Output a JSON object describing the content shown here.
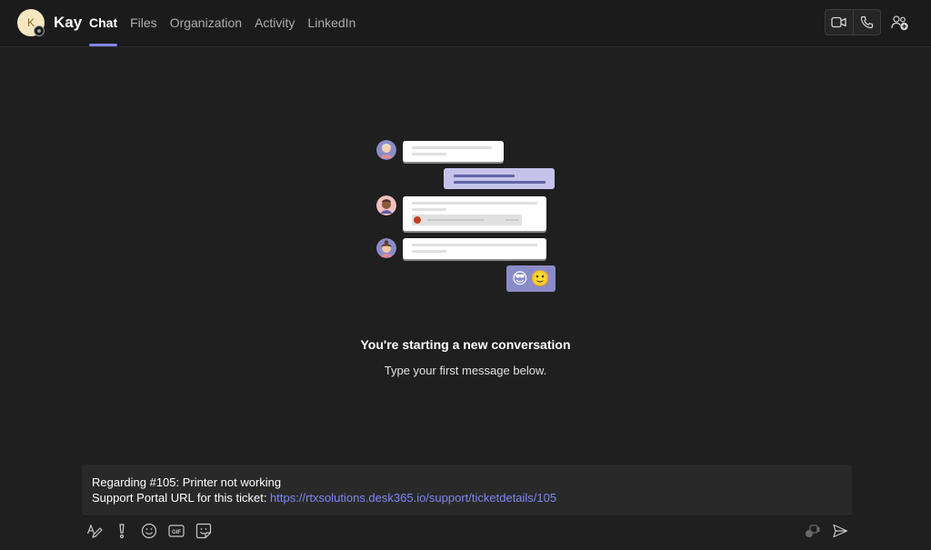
{
  "header": {
    "avatar_initial": "K",
    "user_name": "Kay",
    "tabs": [
      {
        "label": "Chat",
        "active": true
      },
      {
        "label": "Files",
        "active": false
      },
      {
        "label": "Organization",
        "active": false
      },
      {
        "label": "Activity",
        "active": false
      },
      {
        "label": "LinkedIn",
        "active": false
      }
    ],
    "actions": {
      "video_call_icon": "video-camera-icon",
      "audio_call_icon": "phone-icon",
      "add_people_icon": "people-add-icon"
    }
  },
  "empty_state": {
    "title": "You're starting a new conversation",
    "subtitle": "Type your first message below.",
    "emojis": [
      "😎",
      "🙂"
    ]
  },
  "compose": {
    "line1": "Regarding #105: Printer not working",
    "line2_prefix": "Support Portal URL for this ticket: ",
    "link_text": "https://rtxsolutions.desk365.io/support/ticketdetails/105"
  },
  "toolbar": {
    "left_icons": [
      "format-icon",
      "important-icon",
      "emoji-icon",
      "gif-icon",
      "sticker-icon"
    ],
    "right_icons": [
      "loop-icon",
      "send-icon"
    ]
  },
  "colors": {
    "accent": "#7f85f5",
    "background": "#1f1f1f",
    "header_background": "#1b1b1b",
    "compose_background": "#292929"
  }
}
